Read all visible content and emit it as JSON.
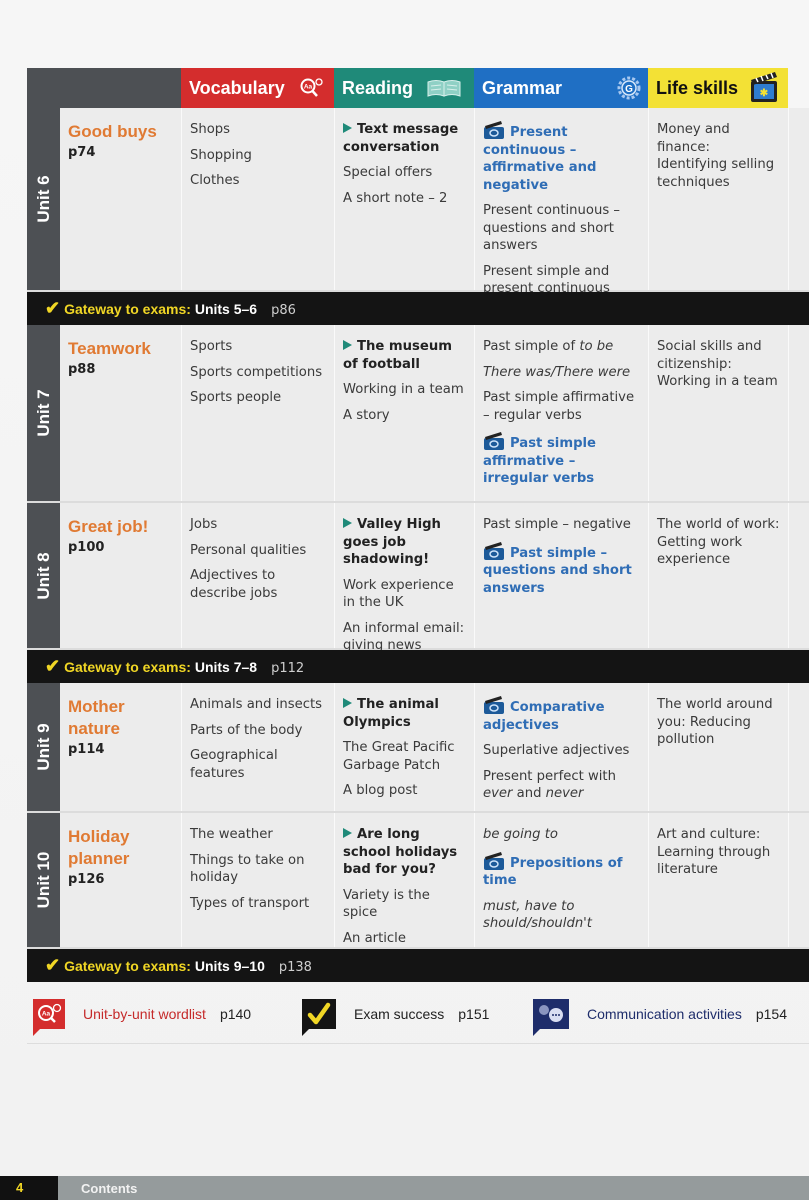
{
  "header": {
    "vocabulary": "Vocabulary",
    "reading": "Reading",
    "grammar": "Grammar",
    "life_skills": "Life skills"
  },
  "colors": {
    "vocabulary": "#d42d2d",
    "reading": "#1f8a79",
    "grammar": "#1f6fc4",
    "life_skills": "#f3e135",
    "unit_title": "#e07a33",
    "video_topic": "#2f6db5",
    "gateway_label": "#f0d625"
  },
  "units": [
    {
      "unit": "Unit 6",
      "title": "Good buys",
      "page": "p74",
      "vocabulary": [
        "Shops",
        "Shopping",
        "Clothes"
      ],
      "reading": {
        "main": "Text message conversation",
        "items": [
          "Special offers",
          "A short note – 2"
        ]
      },
      "grammar": {
        "video": "Present continuous – affirmative and negative",
        "items": [
          "Present continuous – questions and short answers",
          "Present simple and present continuous"
        ]
      },
      "life_skills": "Money and finance: Identifying selling techniques"
    },
    {
      "unit": "Unit 7",
      "title": "Teamwork",
      "page": "p88",
      "vocabulary": [
        "Sports",
        "Sports competitions",
        "Sports people"
      ],
      "reading": {
        "main": "The museum of football",
        "items": [
          "Working in a team",
          "A story"
        ]
      },
      "grammar": {
        "items_before": [
          "Past simple of ",
          "to be",
          "There was/There were",
          "Past simple affirmative – regular verbs"
        ],
        "video": "Past simple affirmative – irregular verbs"
      },
      "life_skills": "Social skills and citizenship: Working in a team"
    },
    {
      "unit": "Unit 8",
      "title": "Great job!",
      "page": "p100",
      "vocabulary": [
        "Jobs",
        "Personal qualities",
        "Adjectives to describe jobs"
      ],
      "reading": {
        "main": "Valley High goes job shadowing!",
        "items": [
          "Work experience in the UK",
          "An informal email: giving news"
        ]
      },
      "grammar": {
        "items_before": [
          "Past simple – negative"
        ],
        "video": "Past simple – questions and short answers"
      },
      "life_skills": "The world of work: Getting work experience"
    },
    {
      "unit": "Unit 9",
      "title": "Mother nature",
      "page": "p114",
      "vocabulary": [
        "Animals and insects",
        "Parts of the body",
        "Geographical features"
      ],
      "reading": {
        "main": "The animal Olympics",
        "items": [
          "The Great Pacific Garbage Patch",
          "A blog post"
        ]
      },
      "grammar": {
        "video": "Comparative adjectives",
        "items": [
          "Superlative adjectives",
          "Present perfect with ",
          "ever",
          " and ",
          "never"
        ]
      },
      "life_skills": "The world around you: Reducing pollution"
    },
    {
      "unit": "Unit 10",
      "title": "Holiday planner",
      "page": "p126",
      "vocabulary": [
        "The weather",
        "Things to take on holiday",
        "Types of transport"
      ],
      "reading": {
        "main": "Are long school holidays bad for you?",
        "items": [
          "Variety is the spice",
          "An article"
        ]
      },
      "grammar": {
        "items_before": [
          "be going to"
        ],
        "video": "Prepositions of time",
        "items": [
          "must, have to should/shouldn't"
        ]
      },
      "life_skills": "Art and culture: Learning through literature"
    }
  ],
  "gateways": [
    {
      "label": "Gateway to exams:",
      "units": "Units 5–6",
      "page": "p86"
    },
    {
      "label": "Gateway to exams:",
      "units": "Units 7–8",
      "page": "p112"
    },
    {
      "label": "Gateway to exams:",
      "units": "Units 9–10",
      "page": "p138"
    }
  ],
  "links": [
    {
      "label": "Unit-by-unit wordlist",
      "page": "p140",
      "icon": "wordlist-magnifier-icon",
      "color": "#d42d2d"
    },
    {
      "label": "Exam success",
      "page": "p151",
      "icon": "checkmark-icon",
      "color": "#141414"
    },
    {
      "label": "Communication activities",
      "page": "p154",
      "icon": "speech-bubbles-icon",
      "color": "#1e2d6b"
    }
  ],
  "footer": {
    "page_number": "4",
    "section": "Contents"
  }
}
